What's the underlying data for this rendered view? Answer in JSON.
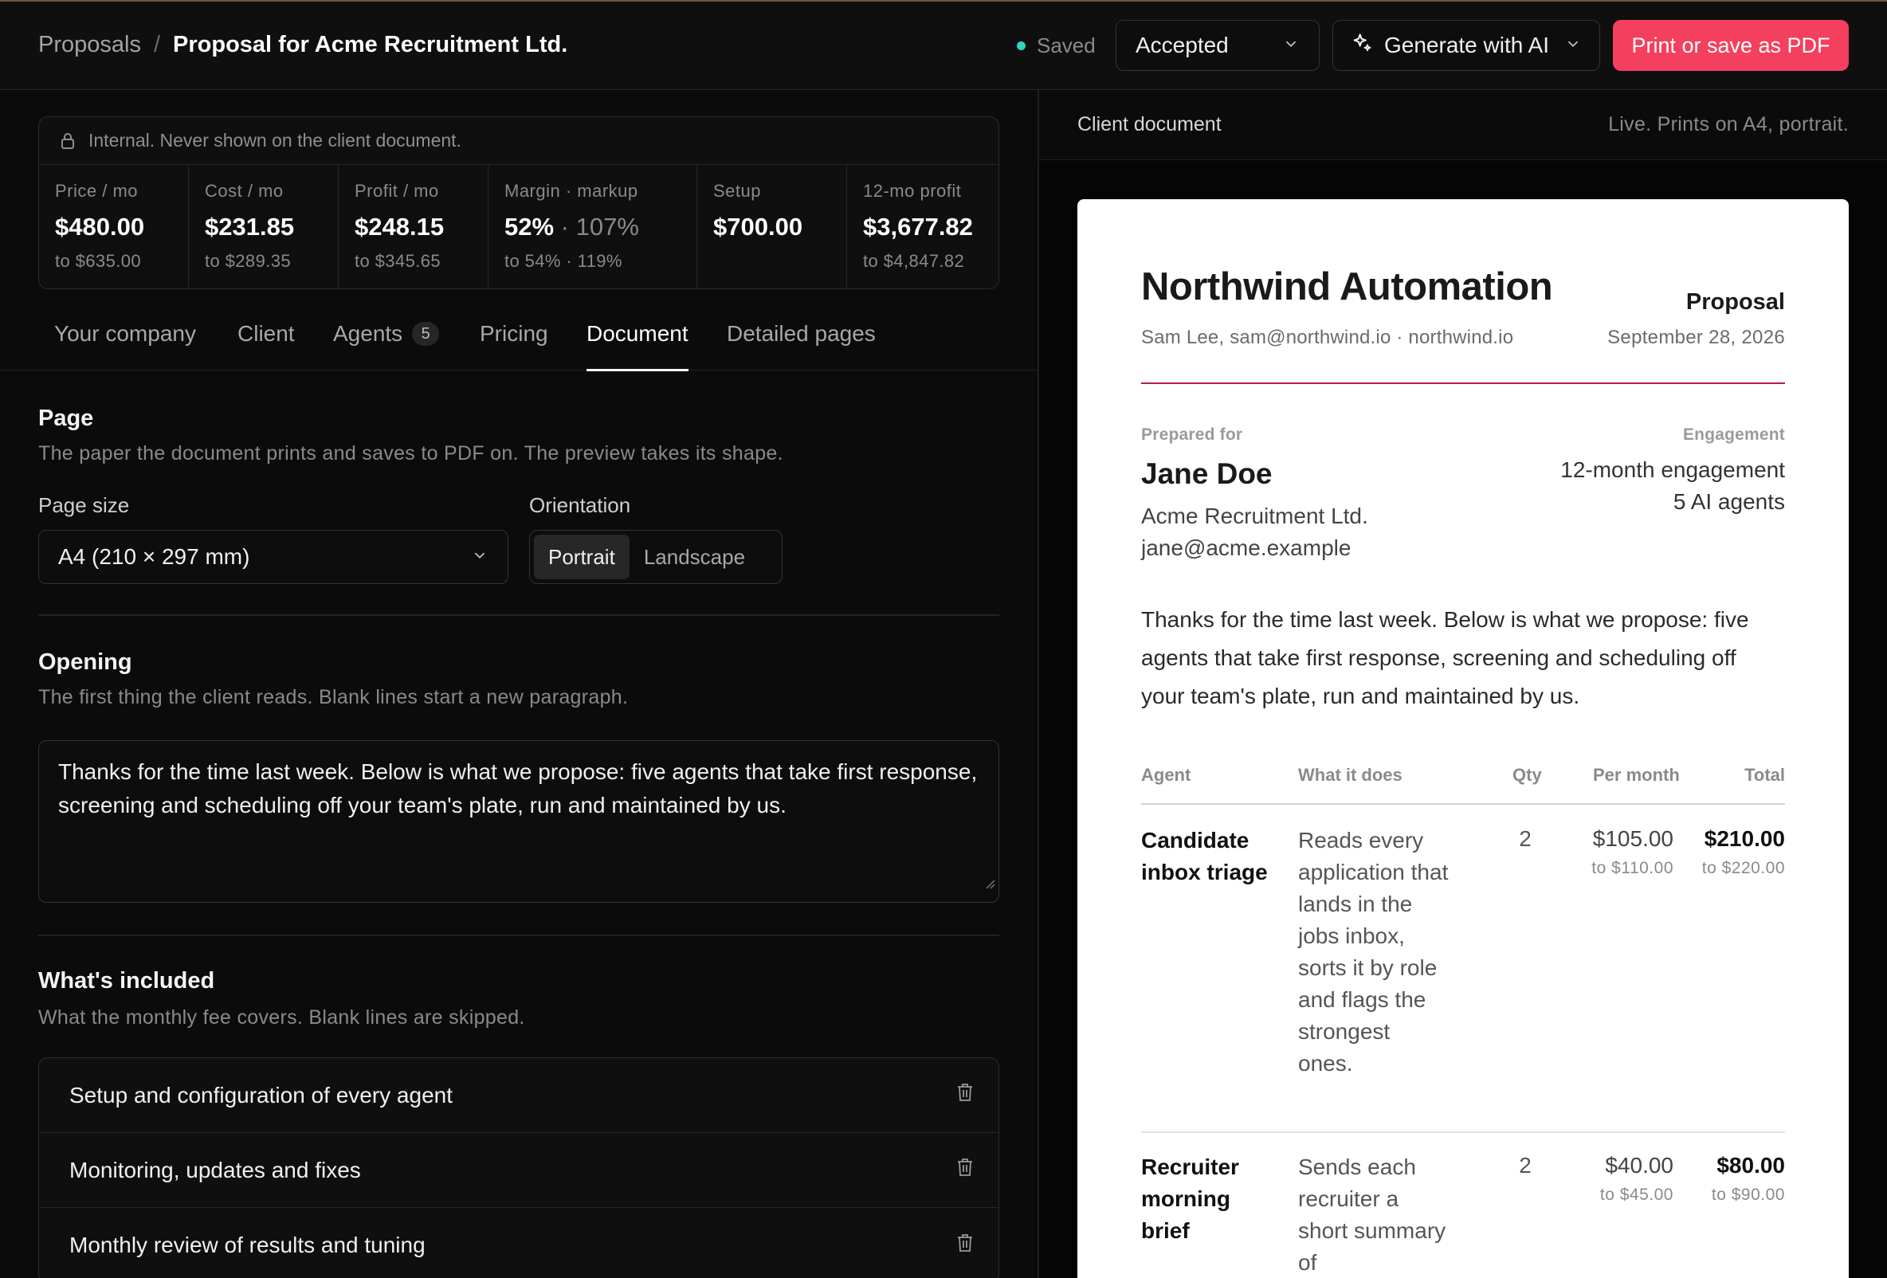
{
  "header": {
    "breadcrumb_root": "Proposals",
    "breadcrumb_sep": "/",
    "breadcrumb_current": "Proposal for Acme Recruitment Ltd.",
    "saved_label": "Saved",
    "status_value": "Accepted",
    "generate_label": "Generate with AI",
    "print_label": "Print or save as PDF"
  },
  "internal": {
    "note": "Internal. Never shown on the client document.",
    "stats": [
      {
        "label": "Price / mo",
        "value": "$480.00",
        "sub": "to $635.00"
      },
      {
        "label": "Cost / mo",
        "value": "$231.85",
        "sub": "to $289.35"
      },
      {
        "label": "Profit / mo",
        "value": "$248.15",
        "sub": "to $345.65"
      },
      {
        "label": "Margin · markup",
        "value": "52%",
        "value_muted": " · 107%",
        "sub": "to 54% · 119%"
      },
      {
        "label": "Setup",
        "value": "$700.00",
        "sub": ""
      },
      {
        "label": "12-mo profit",
        "value": "$3,677.82",
        "sub": "to $4,847.82"
      }
    ]
  },
  "tabs": [
    {
      "label": "Your company"
    },
    {
      "label": "Client"
    },
    {
      "label": "Agents",
      "badge": "5"
    },
    {
      "label": "Pricing"
    },
    {
      "label": "Document"
    },
    {
      "label": "Detailed pages"
    }
  ],
  "page_section": {
    "title": "Page",
    "description": "The paper the document prints and saves to PDF on. The preview takes its shape.",
    "page_size_label": "Page size",
    "page_size_value": "A4 (210 × 297 mm)",
    "orientation_label": "Orientation",
    "orientation_options": [
      "Portrait",
      "Landscape"
    ],
    "orientation_selected": "Portrait"
  },
  "opening_section": {
    "title": "Opening",
    "description": "The first thing the client reads. Blank lines start a new paragraph.",
    "text": "Thanks for the time last week. Below is what we propose: five agents that take first response, screening and scheduling off your team's plate, run and maintained by us."
  },
  "included_section": {
    "title": "What's included",
    "description": "What the monthly fee covers. Blank lines are skipped.",
    "items": [
      "Setup and configuration of every agent",
      "Monitoring, updates and fixes",
      "Monthly review of results and tuning"
    ]
  },
  "preview": {
    "title": "Client document",
    "subtitle": "Live. Prints on A4, portrait.",
    "company": "Northwind Automation",
    "company_contact": "Sam Lee, sam@northwind.io · northwind.io",
    "doc_type": "Proposal",
    "doc_date": "September 28, 2026",
    "prepared_for_label": "Prepared for",
    "client_name": "Jane Doe",
    "client_company": "Acme Recruitment Ltd.",
    "client_email": "jane@acme.example",
    "engagement_label": "Engagement",
    "engagement_term": "12-month engagement",
    "engagement_agents": "5 AI agents",
    "opening": "Thanks for the time last week. Below is what we propose: five agents that take first response, screening and scheduling off your team's plate, run and maintained by us.",
    "table_headers": {
      "agent": "Agent",
      "what": "What it does",
      "qty": "Qty",
      "per_month": "Per month",
      "total": "Total"
    },
    "rows": [
      {
        "name": "Candidate inbox triage",
        "desc": "Reads every application that lands in the jobs inbox, sorts it by role and flags the strongest ones.",
        "qty": "2",
        "per_month": "$105.00",
        "per_month_sub": "to $110.00",
        "total": "$210.00",
        "total_sub": "to $220.00"
      },
      {
        "name": "Recruiter morning brief",
        "desc": "Sends each recruiter a short summary of",
        "qty": "2",
        "per_month": "$40.00",
        "per_month_sub": "to $45.00",
        "total": "$80.00",
        "total_sub": "to $90.00"
      }
    ]
  },
  "colors": {
    "accent": "#f43f5e",
    "saved_dot": "#2dd4bf",
    "doc_rule": "#b21f48"
  }
}
